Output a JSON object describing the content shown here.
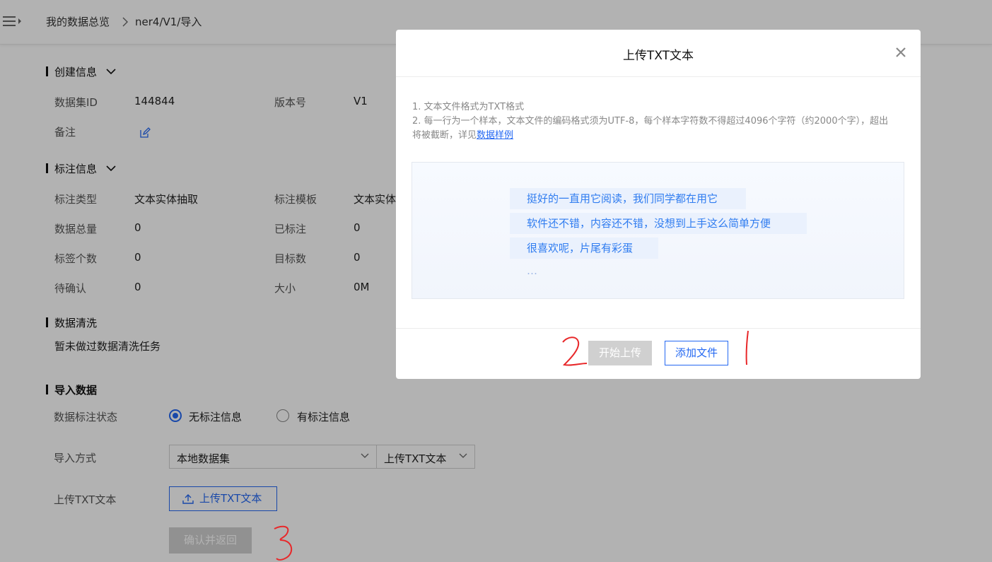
{
  "breadcrumb": {
    "home": "我的数据总览",
    "separator": ">",
    "current": "ner4/V1/导入"
  },
  "sections": {
    "create_info": {
      "title": "创建信息",
      "dataset_id_label": "数据集ID",
      "dataset_id_value": "144844",
      "version_label": "版本号",
      "version_value": "V1",
      "remark_label": "备注"
    },
    "annotation_info": {
      "title": "标注信息",
      "type_label": "标注类型",
      "type_value": "文本实体抽取",
      "template_label": "标注模板",
      "template_value": "文本实体",
      "total_label": "数据总量",
      "total_value": "0",
      "annotated_label": "已标注",
      "annotated_value": "0",
      "tag_count_label": "标签个数",
      "tag_count_value": "0",
      "target_count_label": "目标数",
      "target_count_value": "0",
      "pending_label": "待确认",
      "pending_value": "0",
      "size_label": "大小",
      "size_value": "0M"
    },
    "cleaning": {
      "title": "数据清洗",
      "text": "暂未做过数据清洗任务"
    },
    "import": {
      "title": "导入数据",
      "status_label": "数据标注状态",
      "radio_none": "无标注信息",
      "radio_with": "有标注信息",
      "method_label": "导入方式",
      "method_select": "本地数据集",
      "type_select": "上传TXT文本",
      "upload_label": "上传TXT文本",
      "upload_button": "上传TXT文本",
      "confirm_button": "确认并返回"
    }
  },
  "modal": {
    "title": "上传TXT文本",
    "note1": "1. 文本文件格式为TXT格式",
    "note2a": "2. 每一行为一个样本，文本文件的编码格式须为UTF-8，每个样本字符数不得超过4096个字符（约2000个字），超出",
    "note2b": "将被截断，详见",
    "note2_link": "数据样例",
    "samples": [
      "挺好的一直用它阅读，我们同学都在用它",
      "软件还不错，内容还不错，没想到上手这么简单方便",
      "很喜欢呢，片尾有彩蛋",
      "…"
    ],
    "start_button": "开始上传",
    "add_button": "添加文件"
  },
  "colors": {
    "accent": "#2468f2",
    "annotation_red": "#e8282a",
    "disabled": "#d0d0d0"
  }
}
